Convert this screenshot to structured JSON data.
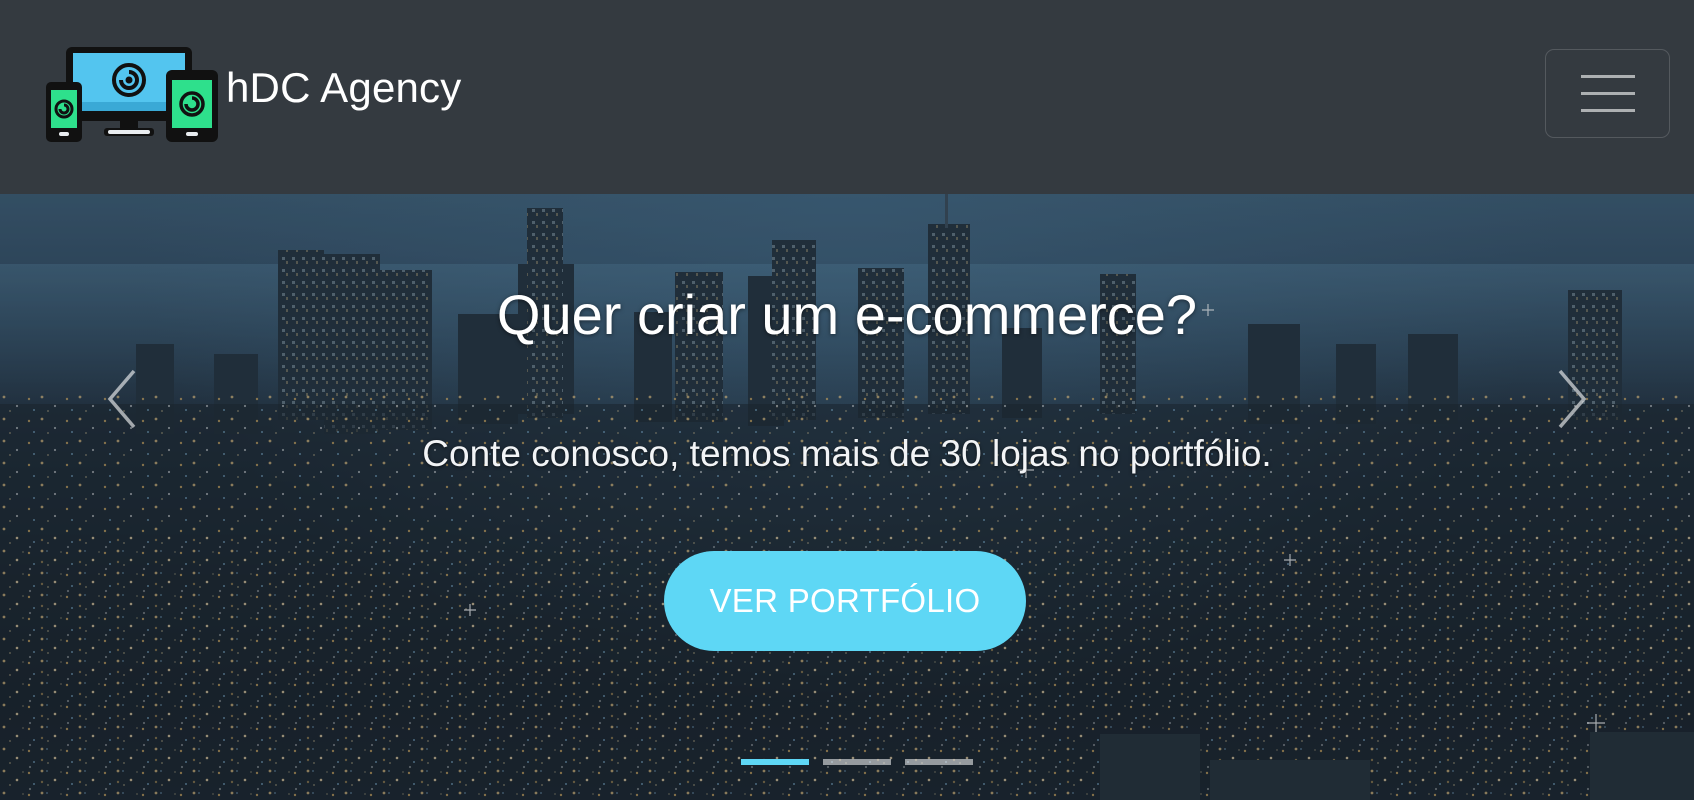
{
  "navbar": {
    "brand_name": "hDC Agency",
    "logo_icon": "responsive-devices-logo",
    "toggler_icon": "hamburger-menu-icon"
  },
  "hero": {
    "title": "Quer criar um e-commerce?",
    "subtitle": "Conte conosco, temos mais de 30 lojas no portfólio.",
    "cta_label": "VER PORTFÓLIO",
    "prev_icon": "chevron-left-icon",
    "next_icon": "chevron-right-icon",
    "slide_count": 3,
    "active_slide": 1
  },
  "colors": {
    "navbar_bg": "#343a40",
    "accent": "#5ed7f5",
    "text": "#ffffff"
  }
}
